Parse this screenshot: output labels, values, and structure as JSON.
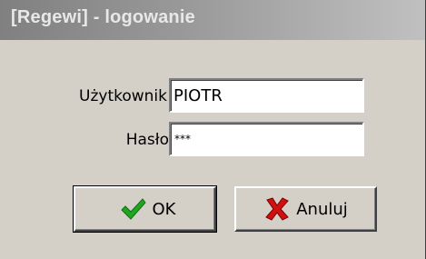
{
  "window": {
    "title": "[Regewi] - logowanie"
  },
  "form": {
    "user_label": "Użytkownik",
    "user_value": "PIOTR",
    "password_label": "Hasło",
    "password_value": "***"
  },
  "buttons": {
    "ok_label": "OK",
    "ok_icon": "checkmark-icon",
    "cancel_label": "Anuluj",
    "cancel_icon": "cross-icon"
  },
  "colors": {
    "titlebar_start": "#808080",
    "titlebar_end": "#c0c0c0",
    "face": "#d4d0c8",
    "check_green": "#1fa51f",
    "cross_red": "#d01010"
  }
}
